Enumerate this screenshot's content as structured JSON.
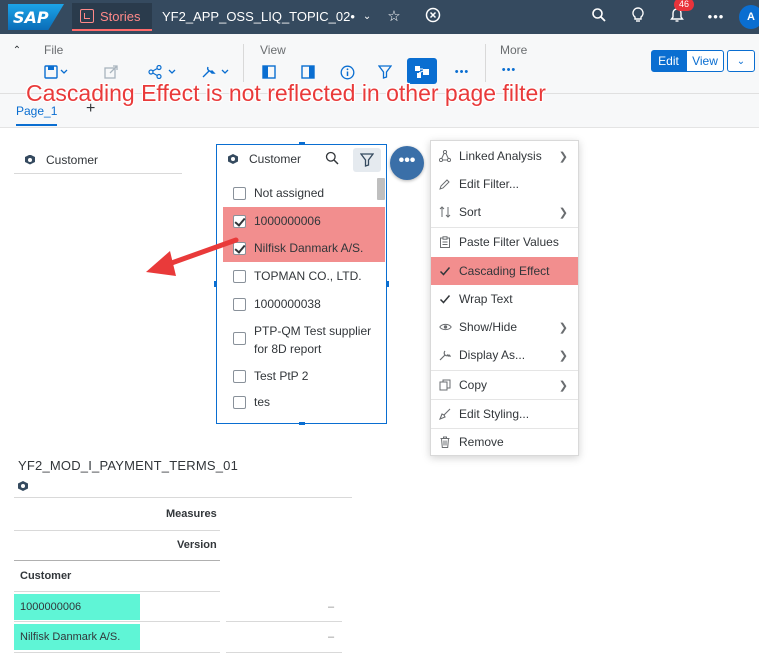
{
  "shell": {
    "logo": "SAP",
    "stories_label": "Stories",
    "story_title": "YF2_APP_OSS_LIQ_TOPIC_02•",
    "notification_count": "46",
    "avatar": "A"
  },
  "toolbar": {
    "file_label": "File",
    "view_label": "View",
    "more_label": "More",
    "edit_label": "Edit",
    "view_mode_label": "View"
  },
  "page_tabs": {
    "active_tab": "Page_1",
    "add": "+"
  },
  "annotation": "Cascading Effect is not reflected in other page filter",
  "left_filter": {
    "label": "Customer"
  },
  "filter_widget": {
    "title": "Customer",
    "items": [
      {
        "label": "Not assigned",
        "checked": false
      },
      {
        "label": "1000000006",
        "checked": true
      },
      {
        "label": "Nilfisk Danmark A/S.",
        "checked": true
      },
      {
        "label": "TOPMAN CO., LTD.",
        "checked": false
      },
      {
        "label": "1000000038",
        "checked": false
      },
      {
        "label": "PTP-QM Test supplier for 8D report",
        "checked": false
      },
      {
        "label": "Test PtP 2",
        "checked": false
      },
      {
        "label": "tes",
        "checked": false
      }
    ]
  },
  "context_menu": {
    "items": [
      {
        "label": "Linked Analysis",
        "icon": "linked-analysis-icon",
        "submenu": true
      },
      {
        "label": "Edit Filter...",
        "icon": "pencil-icon",
        "submenu": false
      },
      {
        "label": "Sort",
        "icon": "sort-icon",
        "submenu": true
      },
      {
        "label": "Paste Filter Values",
        "icon": "paste-icon",
        "submenu": false
      },
      {
        "label": "Cascading Effect",
        "icon": "checkmark-icon",
        "submenu": false,
        "highlighted": true
      },
      {
        "label": "Wrap Text",
        "icon": "checkmark-icon",
        "submenu": false
      },
      {
        "label": "Show/Hide",
        "icon": "eye-icon",
        "submenu": true
      },
      {
        "label": "Display As...",
        "icon": "wrench-icon",
        "submenu": true
      },
      {
        "label": "Copy",
        "icon": "copy-icon",
        "submenu": true
      },
      {
        "label": "Edit Styling...",
        "icon": "brush-icon",
        "submenu": false
      },
      {
        "label": "Remove",
        "icon": "trash-icon",
        "submenu": false
      }
    ]
  },
  "table": {
    "title": "YF2_MOD_I_PAYMENT_TERMS_01",
    "measures_label": "Measures",
    "version_label": "Version",
    "row_header": "Customer",
    "rows": [
      {
        "customer": "1000000006",
        "value": "–"
      },
      {
        "customer": "Nilfisk Danmark A/S.",
        "value": "–"
      }
    ]
  },
  "colors": {
    "shell_bg": "#354a5f",
    "accent": "#0a6ed1",
    "highlight_red": "#f28e8e",
    "highlight_teal": "#5ff5d6",
    "annotation_red": "#e93a3a"
  }
}
